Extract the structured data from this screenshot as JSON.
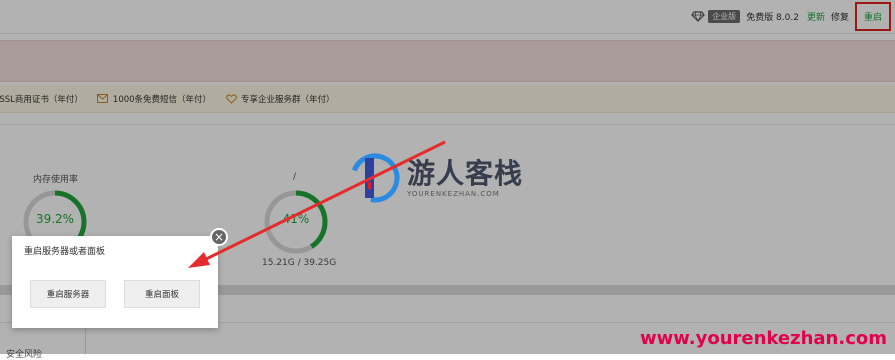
{
  "topbar": {
    "edition_badge": "企业版",
    "version": "免费版 8.0.2",
    "update_label": "更新",
    "repair_label": "修复",
    "restart_label": "重启"
  },
  "promo": {
    "items": [
      {
        "icon": "ssl-icon",
        "label": "ESSL商用证书（年付）"
      },
      {
        "icon": "mail-icon",
        "label": "1000条免费短信（年付）"
      },
      {
        "icon": "handshake-icon",
        "label": "专享企业服务群（年付）"
      }
    ]
  },
  "gauges": {
    "memory": {
      "title": "内存使用率",
      "value_text": "39.2%",
      "percent": 39.2
    },
    "disk": {
      "title": "/",
      "value_text": "41%",
      "percent": 41,
      "usage": "15.21G / 39.25G"
    }
  },
  "dialog": {
    "title": "重启服务器或者面板",
    "restart_server_label": "重启服务器",
    "restart_panel_label": "重启面板",
    "close_symbol": "×"
  },
  "bottom": {
    "cut_label": "安全风险"
  },
  "watermark": {
    "brand": "游人客栈",
    "brand_sub": "YOURENKEZHAN.COM",
    "url": "www.yourenkezhan.com"
  },
  "colors": {
    "accent": "#20a53a",
    "alert": "#e02020",
    "watermark_url": "#e0004c"
  }
}
